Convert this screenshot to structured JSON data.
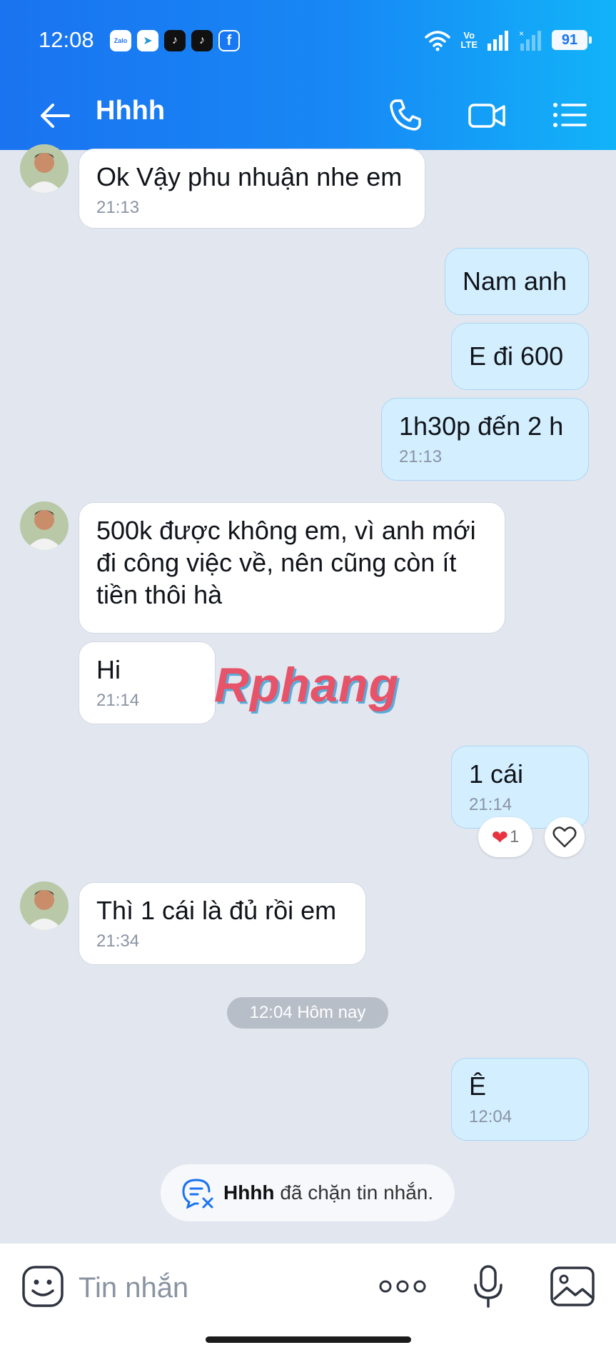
{
  "status_bar": {
    "time": "12:08",
    "battery": "91",
    "network_label_top": "Vo",
    "network_label_bottom": "LTE"
  },
  "header": {
    "title": "Hhhh"
  },
  "messages": [
    {
      "text": "Ok Vậy phu nhuận nhe em",
      "time": "21:13"
    },
    {
      "text": "Nam anh"
    },
    {
      "text": "E đi 600"
    },
    {
      "text": "1h30p đến 2 h",
      "time": "21:13"
    },
    {
      "text": "500k được không em, vì anh mới đi công việc về, nên cũng còn ít tiền thôi hà"
    },
    {
      "text": "Hi",
      "time": "21:14"
    },
    {
      "text": "1 cái",
      "time": "21:14",
      "reaction_count": "1"
    },
    {
      "text": "Thì 1 cái là đủ rồi em",
      "time": "21:34"
    },
    {
      "text": "Ê",
      "time": "12:04"
    }
  ],
  "date_divider": "12:04 Hôm nay",
  "blocked_notice": {
    "name": "Hhhh",
    "text": "đã chặn tin nhắn."
  },
  "watermark": "Rphang",
  "input": {
    "placeholder": "Tin nhắn"
  },
  "colors": {
    "header_start": "#1a73f0",
    "header_end": "#12b3f9",
    "outgoing_bubble": "#d3efff",
    "incoming_bubble": "#ffffff",
    "chat_background": "#e2e6ef"
  }
}
